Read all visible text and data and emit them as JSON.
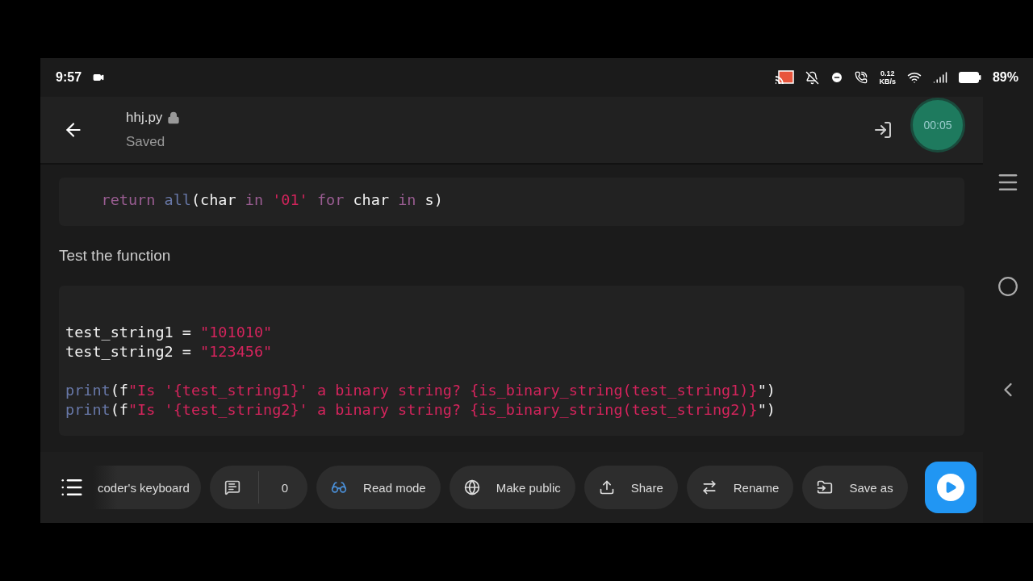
{
  "status_bar": {
    "time": "9:57",
    "net_speed": [
      "0.12",
      "KB/s"
    ],
    "battery": "89%"
  },
  "header": {
    "file_name": "hhj.py",
    "save_state": "Saved",
    "timer": "00:05"
  },
  "blocks": [
    {
      "kind": "code",
      "lines": [
        {
          "kind": "code",
          "tokens": [
            {
              "kind": "keyword",
              "text": "    return"
            },
            {
              "kind": "builtin",
              "text": " all"
            },
            {
              "kind": "plain",
              "text": "(char "
            },
            {
              "kind": "keyword",
              "text": "in"
            },
            {
              "kind": "string",
              "text": " '01'"
            },
            {
              "kind": "keyword",
              "text": " for"
            },
            {
              "kind": "plain",
              "text": " char "
            },
            {
              "kind": "keyword",
              "text": "in"
            },
            {
              "kind": "plain",
              "text": " s)"
            }
          ]
        }
      ]
    },
    {
      "kind": "text",
      "text": "Test the function"
    },
    {
      "kind": "code",
      "lines": [
        {
          "kind": "blank"
        },
        {
          "kind": "code",
          "tokens": [
            {
              "kind": "plain",
              "text": "test_string1 = "
            },
            {
              "kind": "string",
              "text": "\"101010\""
            }
          ]
        },
        {
          "kind": "code",
          "tokens": [
            {
              "kind": "plain",
              "text": "test_string2 = "
            },
            {
              "kind": "string",
              "text": "\"123456\""
            }
          ]
        },
        {
          "kind": "blank"
        },
        {
          "kind": "code",
          "tokens": [
            {
              "kind": "builtin",
              "text": "print"
            },
            {
              "kind": "plain",
              "text": "(f"
            },
            {
              "kind": "string",
              "text": "\"Is '{test_string1}' a binary string? {is_binary_string(test_string1)}"
            },
            {
              "kind": "plain",
              "text": "\")"
            }
          ]
        },
        {
          "kind": "code",
          "tokens": [
            {
              "kind": "builtin",
              "text": "print"
            },
            {
              "kind": "plain",
              "text": "(f"
            },
            {
              "kind": "string",
              "text": "\"Is '{test_string2}' a binary string? {is_binary_string(test_string2)}"
            },
            {
              "kind": "plain",
              "text": "\")"
            }
          ]
        }
      ]
    }
  ],
  "toolbar": [
    {
      "kind": "faded",
      "label": "coder's keyboard"
    },
    {
      "kind": "comments",
      "count": "0"
    },
    {
      "kind": "read",
      "label": "Read mode"
    },
    {
      "kind": "globe",
      "label": "Make public"
    },
    {
      "kind": "share",
      "label": "Share"
    },
    {
      "kind": "rename",
      "label": "Rename"
    },
    {
      "kind": "saveas",
      "label": "Save as"
    }
  ]
}
